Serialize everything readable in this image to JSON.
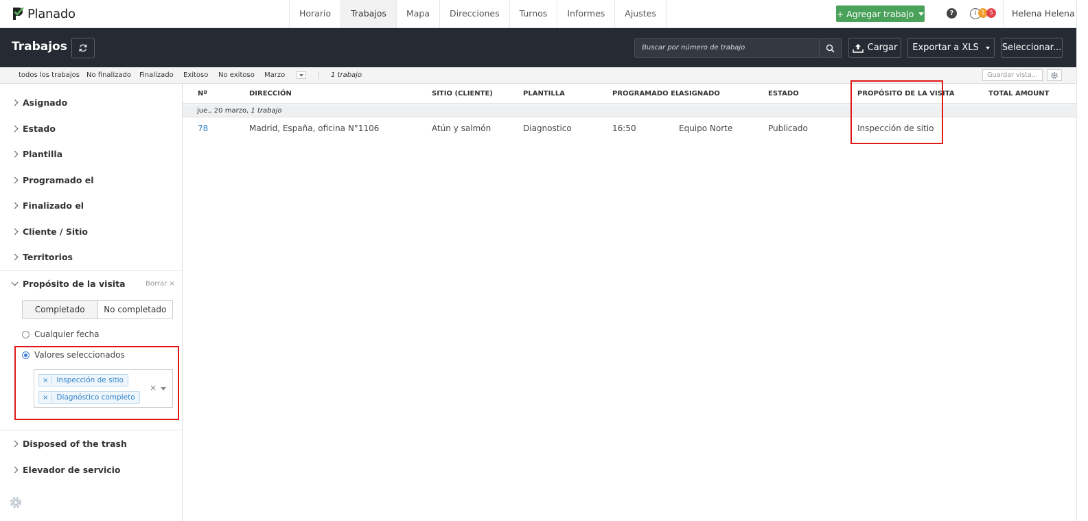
{
  "app": {
    "logo": "Planado"
  },
  "nav": {
    "tabs": [
      "Horario",
      "Trabajos",
      "Mapa",
      "Direcciones",
      "Turnos",
      "Informes",
      "Ajustes"
    ],
    "active": "Trabajos",
    "add_job": "+ Agregar trabajo",
    "help": "?",
    "notif_icon": "i",
    "badge_orange": "1",
    "badge_red": "5",
    "user": "Helena Helena"
  },
  "header": {
    "title": "Trabajos",
    "search_placeholder": "Buscar por número de trabajo",
    "upload": "Cargar",
    "export": "Exportar a XLS",
    "select": "Seleccionar..."
  },
  "filters": {
    "presets": [
      "todos los trabajos",
      "No finalizado",
      "Finalizado",
      "Exitoso",
      "No exitoso",
      "Marzo"
    ],
    "count": "1 trabajo",
    "save_view": "Guardar vista..."
  },
  "sidebar": {
    "sections": [
      "Asignado",
      "Estado",
      "Plantilla",
      "Programado el",
      "Finalizado el",
      "Cliente / Sitio",
      "Territorios"
    ],
    "open_section": "Propósito de la visita",
    "clear": "Borrar ×",
    "segments": [
      "Completado",
      "No completado"
    ],
    "radio_any": "Cualquier fecha",
    "radio_selected": "Valores seleccionados",
    "chips": [
      "Inspección de sitio",
      "Diagnóstico completo"
    ],
    "clear_all": "×",
    "more_sections": [
      "Disposed of the trash",
      "Elevador de servicio"
    ]
  },
  "table": {
    "columns": [
      "Nº",
      "DIRECCIÓN",
      "SITIO (CLIENTE)",
      "PLANTILLA",
      "PROGRAMADO EL",
      "ASIGNADO",
      "ESTADO",
      "PROPÓSITO DE LA VISITA",
      "TOTAL AMOUNT"
    ],
    "group_date": "jue., 20 marzo,",
    "group_count": "1 trabajo",
    "rows": [
      {
        "num": "78",
        "address": "Madrid, España, oficina N°1106",
        "site": "Atún y salmón",
        "template": "Diagnostico",
        "scheduled": "16:50",
        "assignee": "Equipo Norte",
        "status": "Publicado",
        "purpose": "Inspección de sitio",
        "total": ""
      }
    ]
  },
  "colors": {
    "accent_green": "#4aa15a",
    "dark_header": "#262b33",
    "link_blue": "#2f82c9",
    "highlight_red": "#e01818"
  }
}
